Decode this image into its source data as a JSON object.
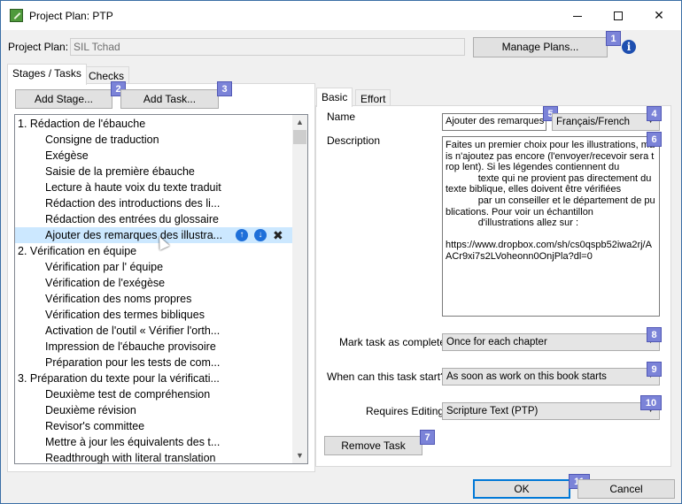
{
  "window": {
    "title": "Project Plan: PTP",
    "minimize_icon": "minimize-icon",
    "maximize_icon": "maximize-icon",
    "close_glyph": "✕"
  },
  "project_plan": {
    "label": "Project Plan:",
    "value": "SIL Tchad",
    "manage_button": "Manage Plans...",
    "info_glyph": "i"
  },
  "left_tabs": [
    "Stages / Tasks",
    "Checks"
  ],
  "stage_buttons": {
    "add_stage": "Add Stage...",
    "add_task": "Add Task..."
  },
  "tree": {
    "rows": [
      {
        "level": 0,
        "text": "1. Rédaction de l'ébauche"
      },
      {
        "level": 1,
        "text": "Consigne de traduction"
      },
      {
        "level": 1,
        "text": "Exégèse"
      },
      {
        "level": 1,
        "text": "Saisie de la première ébauche"
      },
      {
        "level": 1,
        "text": "Lecture à haute voix du texte traduit"
      },
      {
        "level": 1,
        "text": "Rédaction des introductions des li..."
      },
      {
        "level": 1,
        "text": "Rédaction des entrées du glossaire"
      },
      {
        "level": 1,
        "text": "Ajouter des remarques des illustra...",
        "selected": true
      },
      {
        "level": 0,
        "text": "2. Vérification en équipe"
      },
      {
        "level": 1,
        "text": "Vérification par l' équipe"
      },
      {
        "level": 1,
        "text": "Vérification de l'exégèse"
      },
      {
        "level": 1,
        "text": "Vérification des noms propres"
      },
      {
        "level": 1,
        "text": "Vérification des termes bibliques"
      },
      {
        "level": 1,
        "text": "Activation de l'outil « Vérifier l'orth..."
      },
      {
        "level": 1,
        "text": "Impression de l'ébauche provisoire"
      },
      {
        "level": 1,
        "text": "Préparation pour les tests de com..."
      },
      {
        "level": 0,
        "text": "3. Préparation du texte pour la vérificati..."
      },
      {
        "level": 1,
        "text": "Deuxième test de compréhension"
      },
      {
        "level": 1,
        "text": "Deuxième révision"
      },
      {
        "level": 1,
        "text": "Revisor's committee"
      },
      {
        "level": 1,
        "text": "Mettre à jour les équivalents des t..."
      },
      {
        "level": 1,
        "text": "Readthrough with literal translation"
      }
    ],
    "row_actions": {
      "move_up": "↑",
      "move_down": "↓",
      "delete": "✖"
    },
    "scroll_up": "▲",
    "scroll_down": "▼"
  },
  "right_tabs": [
    "Basic",
    "Effort"
  ],
  "task": {
    "name_label": "Name",
    "name_value": "Ajouter des remarques des illustrations",
    "language": "Français/French",
    "description_label": "Description",
    "description": "Faites un premier choix pour les illustrations, mais n'ajoutez pas encore (l'envoyer/recevoir sera trop lent). Si les légendes contiennent du\n            texte qui ne provient pas directement du texte biblique, elles doivent être vérifiées\n            par un conseiller et le département de publications. Pour voir un échantillon\n            d'illustrations allez sur :\n\nhttps://www.dropbox.com/sh/cs0qspb52iwa2rj/AACr9xi7s2LVoheonn0OnjPla?dl=0",
    "complete_label": "Mark task as complete",
    "complete_value": "Once for each chapter",
    "start_label": "When can this task start?",
    "start_value": "As soon as work on this book starts",
    "editing_label": "Requires Editing",
    "editing_value": "Scripture Text (PTP)",
    "remove_button": "Remove Task"
  },
  "footer": {
    "ok": "OK",
    "cancel": "Cancel"
  },
  "badges": [
    "1",
    "2",
    "3",
    "4",
    "5",
    "6",
    "7",
    "8",
    "9",
    "10",
    "11"
  ],
  "colors": {
    "badge": "#7b83d8",
    "selection": "#cce8ff",
    "accent": "#0078d7"
  }
}
